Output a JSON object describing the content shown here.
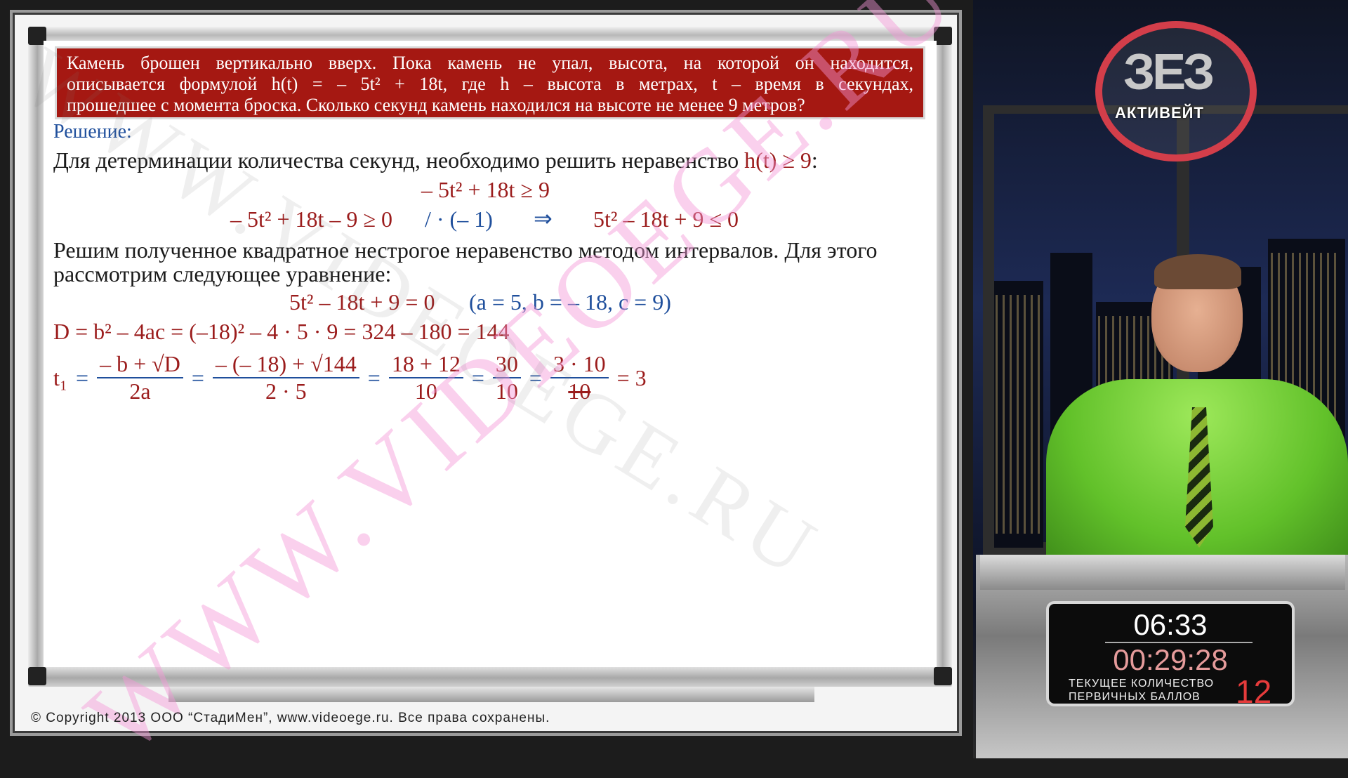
{
  "problem": {
    "line1": "Камень брошен вертикально вверх. Пока камень не упал, высота, на которой он находится,",
    "line2": "описывается формулой h(t) = – 5t² + 18t, где h – высота в метрах, t – время в секундах,",
    "line3": "прошедшее с момента броска. Сколько секунд камень находился на высоте не менее 9 метров?"
  },
  "solution": {
    "heading": "Решение:",
    "intro": "Для детерминации количества секунд, необходимо решить неравенство",
    "intro_expr": "h(t) ≥ 9",
    "intro_colon": ":",
    "ineq1": "– 5t² + 18t ≥ 9",
    "ineq2_left": "– 5t² + 18t – 9 ≥ 0",
    "ineq2_mul": "/ · (– 1)",
    "ineq2_arrow": "⇒",
    "ineq2_right": "5t² – 18t + 9 ≤ 0",
    "para_line1": "Решим полученное квадратное нестрогое неравенство методом интервалов. Для этого",
    "para_line2": "рассмотрим следующее уравнение:",
    "equation": "5t² – 18t + 9 = 0",
    "coeffs": "(a = 5, b = – 18, c = 9)",
    "discriminant": "D = b² – 4ac = (–18)² – 4 · 5 · 9 = 324 – 180 = 144",
    "t1_label": "t₁",
    "eq": "=",
    "f1_num": "– b + √D",
    "f1_den": "2a",
    "f2_num": "– (– 18) + √144",
    "f2_den": "2 · 5",
    "f3_num": "18 + 12",
    "f3_den": "10",
    "f4_num": "30",
    "f4_den": "10",
    "f5_num": "3 · 10",
    "f5_den": "10",
    "result": "= 3"
  },
  "watermark": "WWW.VIDEOEGE.RU",
  "copyright": "© Copyright 2013   ООО “СтадиМен”, www.videoege.ru.   Все права сохранены.",
  "logo": {
    "mark": "ЗЕЗ",
    "text": "АКТИВЕЙТ"
  },
  "scoreboard": {
    "time_current": "06:33",
    "time_total": "00:29:28",
    "label_line1": "ТЕКУЩЕЕ КОЛИЧЕСТВО",
    "label_line2": "ПЕРВИЧНЫХ   БАЛЛОВ",
    "score": "12"
  },
  "colors": {
    "problem_bg": "#a51812",
    "math_blue": "#1f4f9c",
    "math_red": "#9b1c1c",
    "watermark_pink": "#f5b8e0"
  }
}
